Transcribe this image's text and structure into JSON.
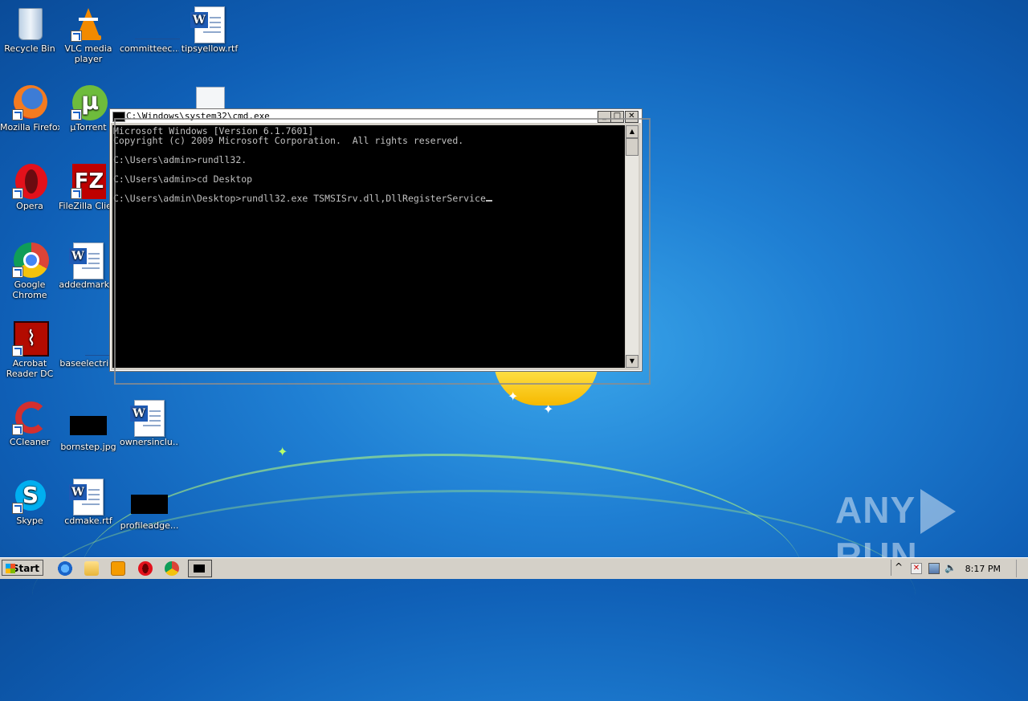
{
  "desktop": {
    "icons": [
      {
        "label": "Recycle Bin",
        "kind": "recycle-bin-icon"
      },
      {
        "label": "VLC media player",
        "kind": "vlc-icon"
      },
      {
        "label": "committeec...",
        "kind": "blank-icon"
      },
      {
        "label": "tipsyellow.rtf",
        "kind": "word-document-icon"
      },
      {
        "label": "Mozilla Firefox",
        "kind": "firefox-icon"
      },
      {
        "label": "µTorrent",
        "kind": "utorrent-icon"
      },
      {
        "label": "Opera",
        "kind": "opera-icon"
      },
      {
        "label": "FileZilla Client",
        "kind": "filezilla-icon"
      },
      {
        "label": "Google Chrome",
        "kind": "chrome-icon"
      },
      {
        "label": "addedmark...",
        "kind": "word-document-icon"
      },
      {
        "label": "Acrobat Reader DC",
        "kind": "acrobat-icon"
      },
      {
        "label": "baseelectri...",
        "kind": "blank-icon"
      },
      {
        "label": "CCleaner",
        "kind": "ccleaner-icon"
      },
      {
        "label": "bornstep.jpg",
        "kind": "image-thumbnail-icon"
      },
      {
        "label": "ownersinclu...",
        "kind": "word-document-icon"
      },
      {
        "label": "Skype",
        "kind": "skype-icon"
      },
      {
        "label": "cdmake.rtf",
        "kind": "word-document-icon"
      },
      {
        "label": "profileadge...",
        "kind": "image-thumbnail-icon"
      }
    ]
  },
  "cmd_window": {
    "title": "C:\\Windows\\system32\\cmd.exe",
    "minimize": "_",
    "maximize": "□",
    "close": "✕",
    "lines": [
      "Microsoft Windows [Version 6.1.7601]",
      "Copyright (c) 2009 Microsoft Corporation.  All rights reserved.",
      "",
      "C:\\Users\\admin>rundll32.",
      "",
      "C:\\Users\\admin>cd Desktop",
      "",
      "C:\\Users\\admin\\Desktop>rundll32.exe TSMSISrv.dll,DllRegisterService"
    ],
    "scroll_up": "▲",
    "scroll_down": "▼"
  },
  "watermark": {
    "left": "ANY",
    "right": "RUN"
  },
  "taskbar": {
    "start_label": "Start",
    "pinned": [
      "internet-explorer-icon",
      "explorer-icon",
      "media-player-icon",
      "opera-icon",
      "chrome-icon",
      "cmd-icon"
    ],
    "tray_expand": "^",
    "clock": "8:17 PM"
  }
}
